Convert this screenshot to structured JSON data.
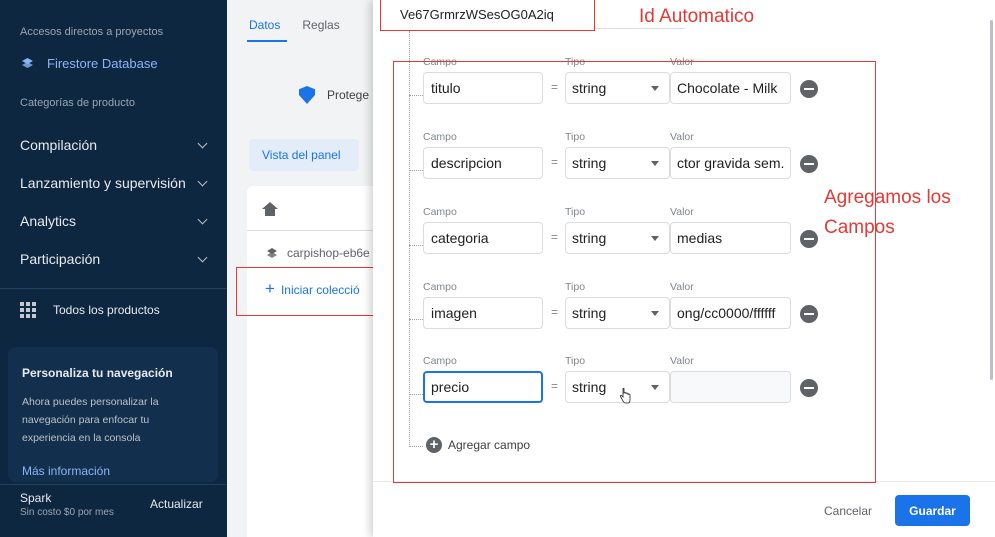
{
  "sidebar": {
    "shortcuts_caption": "Accesos directos a proyectos",
    "firestore_label": "Firestore Database",
    "category_caption": "Categorías de producto",
    "sections": [
      "Compilación",
      "Lanzamiento y supervisión",
      "Analytics",
      "Participación"
    ],
    "all_products": "Todos los productos",
    "promo": {
      "title": "Personaliza tu navegación",
      "description": "Ahora puedes personalizar la navegación para enfocar tu experiencia en la consola",
      "more": "Más información"
    },
    "plan": {
      "name": "Spark",
      "price": "Sin costo $0 por mes",
      "upgrade": "Actualizar"
    }
  },
  "background": {
    "tabs": [
      "Datos",
      "Reglas"
    ],
    "protect_text": "Protege",
    "panel_view": "Vista del panel",
    "project_name": "carpishop-eb6e",
    "start_collection": "Iniciar colecció"
  },
  "dialog": {
    "document_id": "Ve67GrmrzWSesOG0A2iq",
    "labels": {
      "field": "Campo",
      "type": "Tipo",
      "value": "Valor"
    },
    "fields": [
      {
        "name": "titulo",
        "type": "string",
        "value": "Chocolate - Milk"
      },
      {
        "name": "descripcion",
        "type": "string",
        "value": "ctor gravida sem."
      },
      {
        "name": "categoria",
        "type": "string",
        "value": "medias"
      },
      {
        "name": "imagen",
        "type": "string",
        "value": "ong/cc0000/ffffff"
      },
      {
        "name": "precio",
        "type": "string",
        "value": ""
      }
    ],
    "add_field": "Agregar campo",
    "cancel": "Cancelar",
    "save": "Guardar"
  },
  "annotations": {
    "id_note": "Id Automatico",
    "fields_note": "Agregamos los Campos",
    "color": "#e53935"
  }
}
